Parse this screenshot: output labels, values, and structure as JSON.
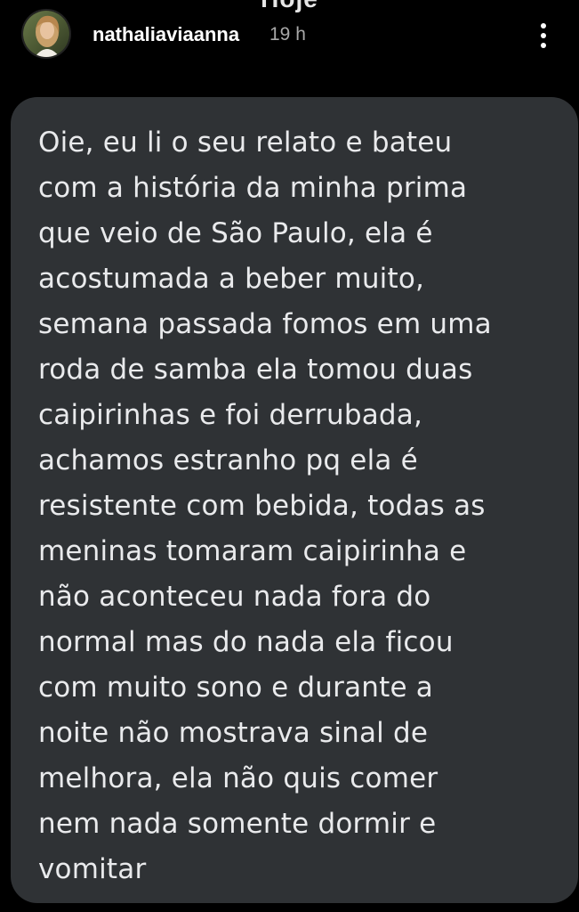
{
  "top_label": "Hoje",
  "header": {
    "username": "nathaliaviaanna",
    "time": "19 h",
    "avatar_icon": "profile-photo",
    "more_icon": "vertical-dots-icon"
  },
  "message": {
    "text": "Oie, eu li o seu relato e bateu\ncom a história da minha prima\nque veio de São Paulo, ela é\nacostumada a beber muito,\nsemana passada fomos em uma\nroda de samba ela tomou duas\ncaipirinhas e foi derrubada,\nachamos estranho pq ela é\nresistente com bebida, todas as\nmeninas tomaram caipirinha e\nnão aconteceu nada fora do\nnormal mas do nada ela ficou\ncom muito sono e durante a\nnoite não mostrava sinal de\nmelhora, ela não quis comer\nnem nada somente dormir e\nvomitar"
  },
  "colors": {
    "background": "#000000",
    "bubble": "#2f3235",
    "text": "#e9eaec",
    "time": "#a8a8a8"
  }
}
